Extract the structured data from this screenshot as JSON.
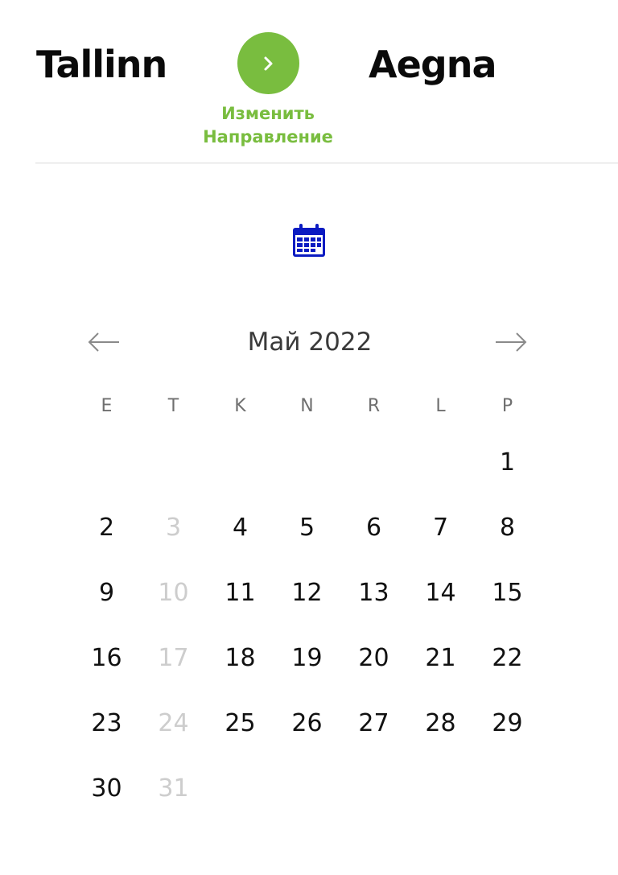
{
  "route": {
    "from": "Tallinn",
    "to": "Aegna",
    "swap_label_line1": "Изменить",
    "swap_label_line2": "Направление",
    "swap_icon": "chevron-right-icon"
  },
  "calendar": {
    "icon": "calendar-icon",
    "month_label": "Май 2022",
    "prev_icon": "arrow-left-icon",
    "next_icon": "arrow-right-icon",
    "weekdays": [
      "E",
      "T",
      "K",
      "N",
      "R",
      "L",
      "P"
    ],
    "weeks": [
      [
        null,
        null,
        null,
        null,
        null,
        null,
        {
          "day": "1",
          "disabled": false
        }
      ],
      [
        {
          "day": "2",
          "disabled": false
        },
        {
          "day": "3",
          "disabled": true
        },
        {
          "day": "4",
          "disabled": false
        },
        {
          "day": "5",
          "disabled": false
        },
        {
          "day": "6",
          "disabled": false
        },
        {
          "day": "7",
          "disabled": false
        },
        {
          "day": "8",
          "disabled": false
        }
      ],
      [
        {
          "day": "9",
          "disabled": false
        },
        {
          "day": "10",
          "disabled": true
        },
        {
          "day": "11",
          "disabled": false
        },
        {
          "day": "12",
          "disabled": false
        },
        {
          "day": "13",
          "disabled": false
        },
        {
          "day": "14",
          "disabled": false
        },
        {
          "day": "15",
          "disabled": false
        }
      ],
      [
        {
          "day": "16",
          "disabled": false
        },
        {
          "day": "17",
          "disabled": true
        },
        {
          "day": "18",
          "disabled": false
        },
        {
          "day": "19",
          "disabled": false
        },
        {
          "day": "20",
          "disabled": false
        },
        {
          "day": "21",
          "disabled": false
        },
        {
          "day": "22",
          "disabled": false
        }
      ],
      [
        {
          "day": "23",
          "disabled": false
        },
        {
          "day": "24",
          "disabled": true
        },
        {
          "day": "25",
          "disabled": false
        },
        {
          "day": "26",
          "disabled": false
        },
        {
          "day": "27",
          "disabled": false
        },
        {
          "day": "28",
          "disabled": false
        },
        {
          "day": "29",
          "disabled": false
        }
      ],
      [
        {
          "day": "30",
          "disabled": false
        },
        {
          "day": "31",
          "disabled": true
        },
        null,
        null,
        null,
        null,
        null
      ]
    ]
  },
  "colors": {
    "accent_green": "#79bd3f",
    "calendar_icon_blue": "#0a1bc2",
    "disabled_day": "#cdcdcd",
    "weekday_label": "#6f6f6f"
  }
}
